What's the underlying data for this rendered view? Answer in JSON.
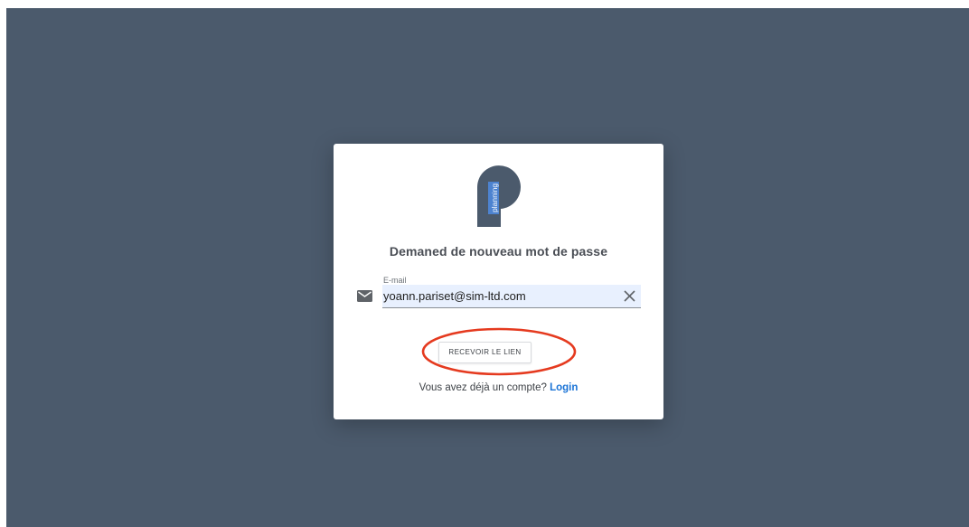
{
  "page": {
    "background_color": "#4b5a6c"
  },
  "card": {
    "logo": {
      "icon": "planning-logo-icon",
      "text": "planning",
      "color_dark": "#4b5a6c",
      "color_accent": "#4d86d6"
    },
    "title": "Demaned de nouveau mot de passe",
    "email_field": {
      "label": "E-mail",
      "value": "yoann.pariset@sim-ltd.com",
      "leading_icon": "envelope-icon",
      "trailing_icon": "clear-icon"
    },
    "submit_button": {
      "label": "RECEVOIR LE LIEN",
      "annotation_color": "#e53a1f"
    },
    "footer": {
      "prompt": "Vous avez déjà un compte?",
      "link_label": "Login",
      "link_color": "#1a73d6"
    }
  }
}
